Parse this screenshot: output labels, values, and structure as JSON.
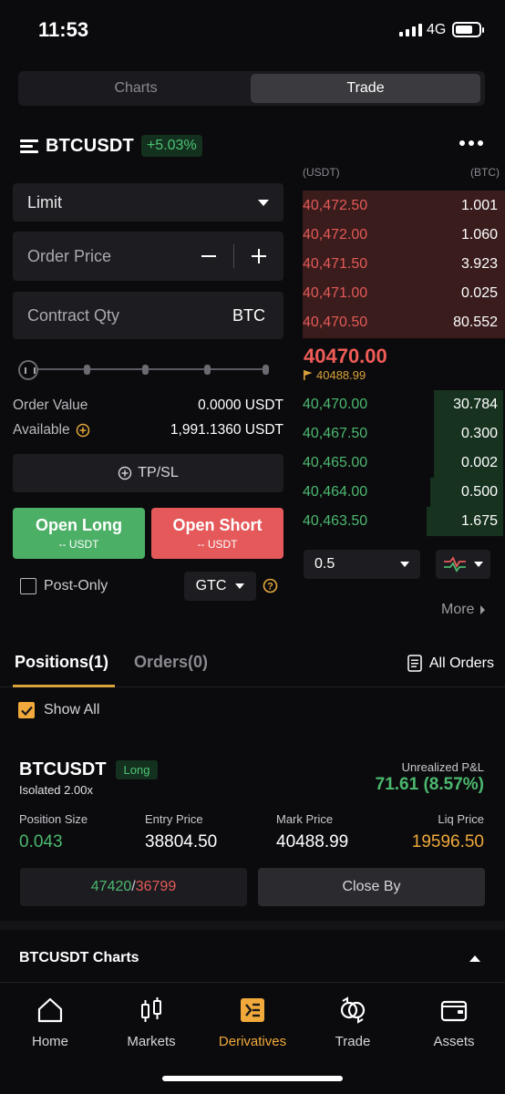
{
  "status_bar": {
    "time": "11:53",
    "network": "4G"
  },
  "segment": {
    "charts": "Charts",
    "trade": "Trade"
  },
  "pair": {
    "symbol": "BTCUSDT",
    "change": "+5.03%"
  },
  "order_form": {
    "order_type": "Limit",
    "price_placeholder": "Order Price",
    "qty_placeholder": "Contract Qty",
    "qty_unit": "BTC",
    "order_value_label": "Order Value",
    "order_value": "0.0000 USDT",
    "available_label": "Available",
    "available": "1,991.1360 USDT",
    "tpsl": "TP/SL",
    "open_long": "Open Long",
    "open_long_sub": "-- USDT",
    "open_short": "Open Short",
    "open_short_sub": "-- USDT",
    "post_only": "Post-Only",
    "tif": "GTC"
  },
  "orderbook": {
    "price_header": "(USDT)",
    "qty_header": "(BTC)",
    "asks": [
      {
        "price": "40,472.50",
        "qty": "1.001"
      },
      {
        "price": "40,472.00",
        "qty": "1.060"
      },
      {
        "price": "40,471.50",
        "qty": "3.923"
      },
      {
        "price": "40,471.00",
        "qty": "0.025"
      },
      {
        "price": "40,470.50",
        "qty": "80.552"
      }
    ],
    "last_price": "40470.00",
    "mark_price": "40488.99",
    "bids": [
      {
        "price": "40,470.00",
        "qty": "30.784"
      },
      {
        "price": "40,467.50",
        "qty": "0.300"
      },
      {
        "price": "40,465.00",
        "qty": "0.002"
      },
      {
        "price": "40,464.00",
        "qty": "0.500"
      },
      {
        "price": "40,463.50",
        "qty": "1.675"
      }
    ],
    "depth_step": "0.5",
    "more": "More"
  },
  "tabs": {
    "positions": "Positions(1)",
    "orders": "Orders(0)",
    "all_orders": "All Orders"
  },
  "show_all": "Show All",
  "position": {
    "symbol": "BTCUSDT",
    "side": "Long",
    "margin_mode": "Isolated 2.00x",
    "upnl_label": "Unrealized P&L",
    "upnl": "71.61 (8.57%)",
    "size_label": "Position Size",
    "size": "0.043",
    "entry_label": "Entry Price",
    "entry": "38804.50",
    "mark_label": "Mark Price",
    "mark": "40488.99",
    "liq_label": "Liq Price",
    "liq": "19596.50",
    "tp": "47420",
    "sl": "36799",
    "close_by": "Close By"
  },
  "charts_section": "BTCUSDT Charts",
  "nav": {
    "home": "Home",
    "markets": "Markets",
    "derivatives": "Derivatives",
    "trade": "Trade",
    "assets": "Assets"
  },
  "colors": {
    "green": "#4cb86e",
    "red": "#e35a58",
    "accent": "#f0a93a"
  }
}
